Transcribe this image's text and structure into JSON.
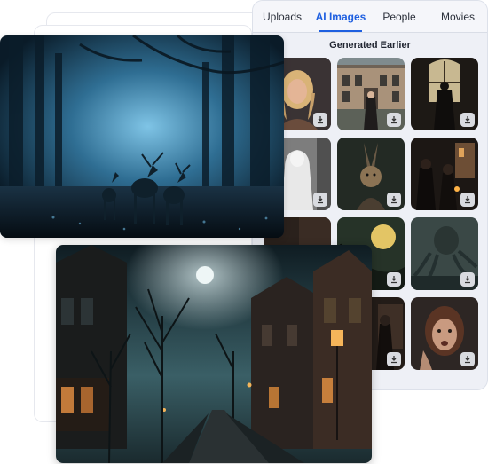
{
  "tabs": [
    {
      "label": "Uploads",
      "active": false
    },
    {
      "label": "AI Images",
      "active": true
    },
    {
      "label": "People",
      "active": false
    },
    {
      "label": "Movies",
      "active": false
    }
  ],
  "section_title": "Generated Earlier",
  "accent_color": "#1e5fe0",
  "thumbnails": [
    {
      "subject": "blonde-woman-portrait"
    },
    {
      "subject": "woman-in-front-of-building"
    },
    {
      "subject": "figure-at-window"
    },
    {
      "subject": "ghost-in-sheet"
    },
    {
      "subject": "rabbit-creature"
    },
    {
      "subject": "women-with-candle"
    },
    {
      "subject": "dark-partial"
    },
    {
      "subject": "full-moon-rider"
    },
    {
      "subject": "octopus-monster"
    },
    {
      "subject": "dark-partial"
    },
    {
      "subject": "dark-figure"
    },
    {
      "subject": "frightened-woman"
    }
  ],
  "icons": {
    "download": "download-icon"
  }
}
